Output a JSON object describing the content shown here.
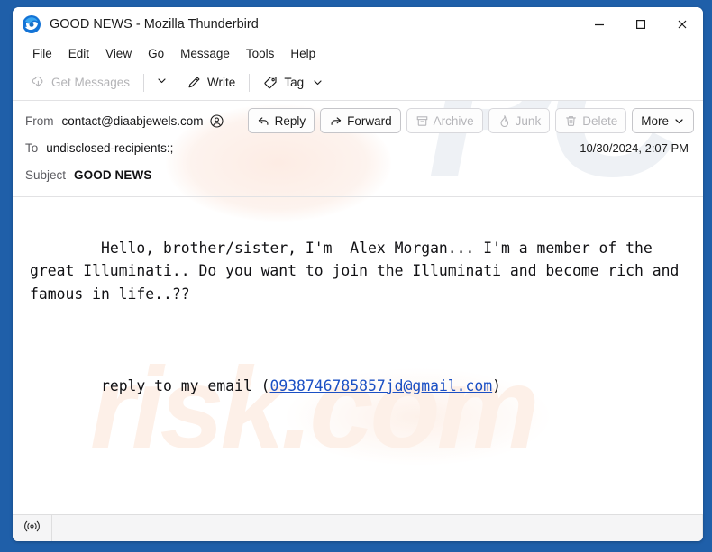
{
  "window": {
    "title": "GOOD NEWS - Mozilla Thunderbird",
    "logo_icon": "thunderbird-logo",
    "controls": {
      "minimize": "minimize-icon",
      "maximize": "maximize-icon",
      "close": "close-icon"
    }
  },
  "menubar": {
    "items": [
      {
        "label": "File",
        "accesskey": "F"
      },
      {
        "label": "Edit",
        "accesskey": "E"
      },
      {
        "label": "View",
        "accesskey": "V"
      },
      {
        "label": "Go",
        "accesskey": "G"
      },
      {
        "label": "Message",
        "accesskey": "M"
      },
      {
        "label": "Tools",
        "accesskey": "T"
      },
      {
        "label": "Help",
        "accesskey": "H"
      }
    ]
  },
  "toolbar": {
    "get_messages_label": "Get Messages",
    "get_messages_icon": "cloud-download-icon",
    "get_messages_disabled": true,
    "get_messages_chevron_icon": "chevron-down-icon",
    "write_label": "Write",
    "write_icon": "pencil-icon",
    "tag_label": "Tag",
    "tag_icon": "tag-icon",
    "tag_chevron_icon": "chevron-down-icon"
  },
  "header": {
    "from_label": "From",
    "from_value": "contact@diaabjewels.com",
    "from_contact_icon": "contact-circle-icon",
    "to_label": "To",
    "to_value": "undisclosed-recipients:;",
    "subject_label": "Subject",
    "subject_value": "GOOD NEWS",
    "date": "10/30/2024, 2:07 PM",
    "actions": [
      {
        "label": "Reply",
        "icon": "reply-arrow-icon",
        "disabled": false
      },
      {
        "label": "Forward",
        "icon": "forward-arrow-icon",
        "disabled": false
      },
      {
        "label": "Archive",
        "icon": "archive-box-icon",
        "disabled": true
      },
      {
        "label": "Junk",
        "icon": "flame-icon",
        "disabled": true
      },
      {
        "label": "Delete",
        "icon": "trash-icon",
        "disabled": true
      },
      {
        "label": "More",
        "icon": "chevron-down-icon",
        "disabled": false
      }
    ]
  },
  "message": {
    "paragraph_1": "Hello, brother/sister, I'm  Alex Morgan... I'm a member of the great Illuminati.. Do you want to join the Illuminati and become rich and famous in life..??",
    "reply_prefix": "reply to my email (",
    "reply_email": "0938746785857jd@gmail.com",
    "reply_suffix": ")"
  },
  "statusbar": {
    "indicator_icon": "broadcast-signal-icon"
  },
  "watermarks": {
    "upper": "PC",
    "lower": "risk.com"
  },
  "colors": {
    "window_frame": "#1f5fa9",
    "link": "#1a4fc4",
    "disabled_text": "#b3b3b6",
    "label_text": "#5b5b60",
    "watermark_upper": "#eef1f5",
    "watermark_lower": "#fdf0e8"
  }
}
